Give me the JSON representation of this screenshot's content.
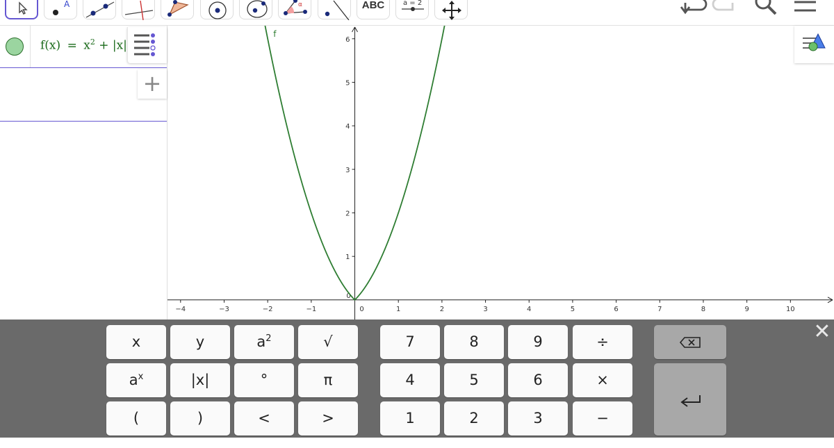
{
  "toolbar": {
    "text_tool_label": "ABC",
    "tools": [
      {
        "name": "move-tool",
        "icon": "arrow-cursor-icon",
        "active": true
      },
      {
        "name": "point-tool",
        "icon": "point-icon"
      },
      {
        "name": "line-tool",
        "icon": "line-icon"
      },
      {
        "name": "perpendicular-tool",
        "icon": "perpendicular-line-icon"
      },
      {
        "name": "polygon-tool",
        "icon": "polygon-icon"
      },
      {
        "name": "circle-center-tool",
        "icon": "circle-center-icon"
      },
      {
        "name": "circle-tool",
        "icon": "circle-icon"
      },
      {
        "name": "angle-tool",
        "icon": "angle-icon"
      },
      {
        "name": "reflect-tool",
        "icon": "reflect-icon"
      },
      {
        "name": "text-tool",
        "icon": "text-icon"
      },
      {
        "name": "slider-tool",
        "icon": "slider-icon"
      },
      {
        "name": "move-graphics-tool",
        "icon": "move-graphics-icon"
      }
    ],
    "right_buttons": [
      "undo-icon",
      "redo-icon",
      "search-icon",
      "menu-icon"
    ]
  },
  "algebra": {
    "entries": [
      {
        "formula_lhs": "f(x)",
        "eq": "=",
        "formula_rhs_base": "x",
        "formula_rhs_exp": "2",
        "formula_rhs_tail": " + |x|",
        "color": "#1a6a1a"
      }
    ],
    "add_icon": "plus-icon"
  },
  "graph": {
    "function_label": "f",
    "function_color": "#2e7d32",
    "x_ticks": [
      "−4",
      "−3",
      "−2",
      "−1",
      "0",
      "1",
      "2",
      "3",
      "4",
      "5",
      "6",
      "7",
      "8",
      "9",
      "10"
    ],
    "y_ticks": [
      "1",
      "2",
      "3",
      "4",
      "5",
      "6"
    ],
    "origin_label": "0"
  },
  "chart_data": {
    "type": "line",
    "series": [
      {
        "name": "f",
        "function": "f(x) = x^2 + |x|"
      }
    ],
    "x_range": [
      -4.3,
      11
    ],
    "y_range": [
      -0.45,
      6.3
    ]
  },
  "keyboard": {
    "close_icon": "close-icon",
    "rows": [
      [
        "x",
        "y",
        "a2",
        "√",
        "7",
        "8",
        "9",
        "÷"
      ],
      [
        "ax",
        "|x|",
        "°",
        "π",
        "4",
        "5",
        "6",
        "×"
      ],
      [
        "(",
        ")",
        "<",
        ">",
        "1",
        "2",
        "3",
        "−"
      ]
    ],
    "backspace_icon": "backspace-icon",
    "enter_icon": "enter-icon",
    "sup_2": "2",
    "sup_x": "x"
  }
}
